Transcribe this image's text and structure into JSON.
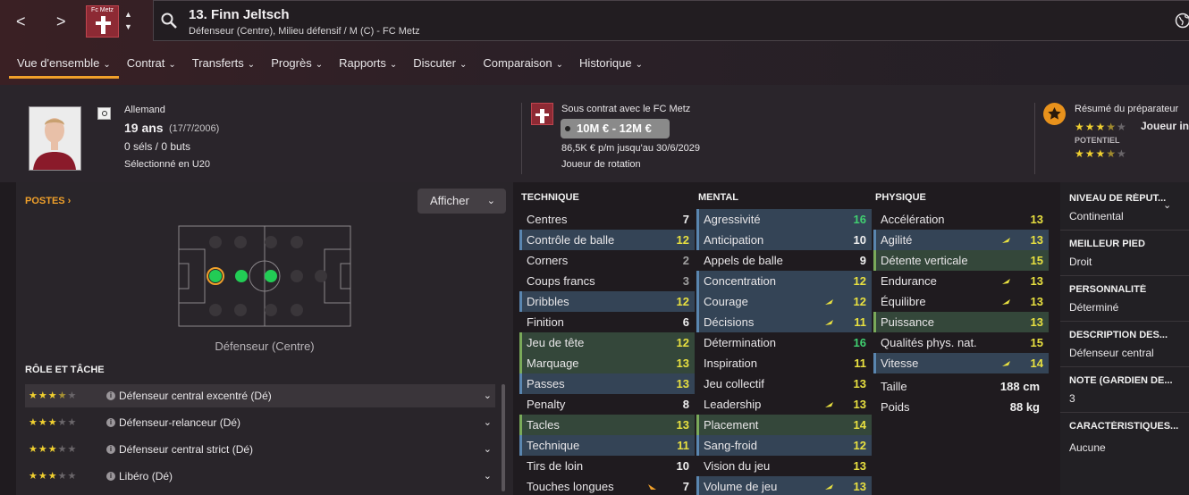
{
  "nav": {
    "back": "<",
    "forward": ">"
  },
  "club": {
    "crest_text": "Fc Metz"
  },
  "header": {
    "title": "13. Finn Jeltsch",
    "subtitle": "Défenseur (Centre), Milieu défensif / M (C) - FC Metz"
  },
  "tabs": [
    {
      "label": "Vue d'ensemble"
    },
    {
      "label": "Contrat"
    },
    {
      "label": "Transferts"
    },
    {
      "label": "Progrès"
    },
    {
      "label": "Rapports"
    },
    {
      "label": "Discuter"
    },
    {
      "label": "Comparaison"
    },
    {
      "label": "Historique"
    }
  ],
  "profile": {
    "nationality": "Allemand",
    "age": "19 ans",
    "dob": "(17/7/2006)",
    "caps": "0 séls / 0 buts",
    "selection": "Sélectionné en U20"
  },
  "contract": {
    "club_text": "Sous contrat avec le FC Metz",
    "value": "10M € - 12M €",
    "wage": "86,5K € p/m jusqu'au 30/6/2029",
    "status": "Joueur de rotation"
  },
  "scout": {
    "title": "Résumé du préparateur",
    "verdict": "Joueur in",
    "potential_label": "POTENTIEL",
    "ability_stars": 3.5,
    "potential_stars": 3.5
  },
  "positions": {
    "title": "POSTES",
    "show_button": "Afficher",
    "position_label": "Défenseur (Centre)"
  },
  "roles": {
    "title": "RÔLE ET TÂCHE",
    "items": [
      {
        "name": "Défenseur central excentré (Dé)",
        "stars": 3.5
      },
      {
        "name": "Défenseur-relanceur (Dé)",
        "stars": 3
      },
      {
        "name": "Défenseur central strict (Dé)",
        "stars": 3
      },
      {
        "name": "Libéro (Dé)",
        "stars": 3
      }
    ]
  },
  "attributes": {
    "technique": {
      "title": "TECHNIQUE",
      "rows": [
        {
          "name": "Centres",
          "value": "7",
          "hl": "",
          "color": "w"
        },
        {
          "name": "Contrôle de balle",
          "value": "12",
          "hl": "blue",
          "color": "y"
        },
        {
          "name": "Corners",
          "value": "2",
          "hl": "",
          "color": "gr"
        },
        {
          "name": "Coups francs",
          "value": "3",
          "hl": "",
          "color": "gr"
        },
        {
          "name": "Dribbles",
          "value": "12",
          "hl": "blue",
          "color": "y"
        },
        {
          "name": "Finition",
          "value": "6",
          "hl": "",
          "color": "w"
        },
        {
          "name": "Jeu de tête",
          "value": "12",
          "hl": "green",
          "color": "y"
        },
        {
          "name": "Marquage",
          "value": "13",
          "hl": "green",
          "color": "y"
        },
        {
          "name": "Passes",
          "value": "13",
          "hl": "blue",
          "color": "y"
        },
        {
          "name": "Penalty",
          "value": "8",
          "hl": "",
          "color": "w"
        },
        {
          "name": "Tacles",
          "value": "13",
          "hl": "green",
          "color": "y"
        },
        {
          "name": "Technique",
          "value": "11",
          "hl": "blue",
          "color": "y"
        },
        {
          "name": "Tirs de loin",
          "value": "10",
          "hl": "",
          "color": "w"
        },
        {
          "name": "Touches longues",
          "value": "7",
          "hl": "",
          "color": "w",
          "trend": "down"
        }
      ]
    },
    "mental": {
      "title": "MENTAL",
      "rows": [
        {
          "name": "Agressivité",
          "value": "16",
          "hl": "blue",
          "color": "g"
        },
        {
          "name": "Anticipation",
          "value": "10",
          "hl": "blue",
          "color": "w"
        },
        {
          "name": "Appels de balle",
          "value": "9",
          "hl": "",
          "color": "w"
        },
        {
          "name": "Concentration",
          "value": "12",
          "hl": "blue",
          "color": "y"
        },
        {
          "name": "Courage",
          "value": "12",
          "hl": "blue",
          "color": "y",
          "trend": "up"
        },
        {
          "name": "Décisions",
          "value": "11",
          "hl": "blue",
          "color": "y",
          "trend": "up"
        },
        {
          "name": "Détermination",
          "value": "16",
          "hl": "",
          "color": "g"
        },
        {
          "name": "Inspiration",
          "value": "11",
          "hl": "",
          "color": "y"
        },
        {
          "name": "Jeu collectif",
          "value": "13",
          "hl": "",
          "color": "y"
        },
        {
          "name": "Leadership",
          "value": "13",
          "hl": "",
          "color": "y",
          "trend": "up"
        },
        {
          "name": "Placement",
          "value": "14",
          "hl": "green",
          "color": "y"
        },
        {
          "name": "Sang-froid",
          "value": "12",
          "hl": "blue",
          "color": "y"
        },
        {
          "name": "Vision du jeu",
          "value": "13",
          "hl": "",
          "color": "y"
        },
        {
          "name": "Volume de jeu",
          "value": "13",
          "hl": "blue",
          "color": "y",
          "trend": "up"
        }
      ]
    },
    "physique": {
      "title": "PHYSIQUE",
      "rows": [
        {
          "name": "Accélération",
          "value": "13",
          "hl": "",
          "color": "y"
        },
        {
          "name": "Agilité",
          "value": "13",
          "hl": "blue",
          "color": "y",
          "trend": "up"
        },
        {
          "name": "Détente verticale",
          "value": "15",
          "hl": "green",
          "color": "y"
        },
        {
          "name": "Endurance",
          "value": "13",
          "hl": "",
          "color": "y",
          "trend": "up"
        },
        {
          "name": "Équilibre",
          "value": "13",
          "hl": "",
          "color": "y",
          "trend": "up"
        },
        {
          "name": "Puissance",
          "value": "13",
          "hl": "green",
          "color": "y"
        },
        {
          "name": "Qualités phys. nat.",
          "value": "15",
          "hl": "",
          "color": "y"
        },
        {
          "name": "Vitesse",
          "value": "14",
          "hl": "blue",
          "color": "y",
          "trend": "up"
        }
      ]
    },
    "measures": [
      {
        "name": "Taille",
        "value": "188 cm"
      },
      {
        "name": "Poids",
        "value": "88 kg"
      }
    ]
  },
  "sidebar": {
    "items": [
      {
        "label": "NIVEAU DE RÉPUT...",
        "value": "Continental"
      },
      {
        "label": "MEILLEUR PIED",
        "value": "Droit"
      },
      {
        "label": "PERSONNALITÉ",
        "value": "Déterminé"
      },
      {
        "label": "DESCRIPTION DES...",
        "value": "Défenseur central"
      },
      {
        "label": "NOTE (GARDIEN DE...",
        "value": "3"
      },
      {
        "label": "CARACTÉRISTIQUES...",
        "value": "Aucune"
      }
    ]
  },
  "colors": {
    "accent": "#f0a02a",
    "blue_hl": "#344456",
    "green_hl": "#34473a",
    "position_green": "#22cc55"
  }
}
